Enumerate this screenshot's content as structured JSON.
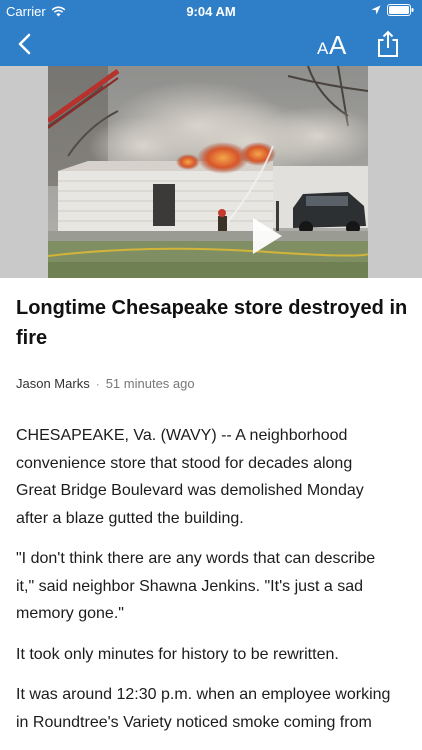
{
  "status_bar": {
    "carrier": "Carrier",
    "time": "9:04 AM",
    "icons": [
      "wifi-icon",
      "location-arrow-icon",
      "battery-icon"
    ]
  },
  "nav_bar": {
    "icons": [
      "back-chevron-icon",
      "text-size-icon",
      "share-icon"
    ],
    "text_size_glyph": "AA"
  },
  "hero": {
    "type": "video",
    "icons": [
      "play-icon"
    ]
  },
  "article": {
    "headline": "Longtime Chesapeake store destroyed in fire",
    "author": "Jason Marks",
    "separator": "·",
    "time_ago": "51 minutes ago",
    "paragraphs": [
      "CHESAPEAKE, Va. (WAVY) -- A neighborhood convenience store that stood for decades along Great Bridge Boulevard was demolished Monday after a blaze gutted the building.",
      "\"I don't think there are any words that can describe it,\" said neighbor Shawna Jenkins. \"It's just a sad memory gone.\"",
      "It took only minutes for history to be rewritten.",
      "It was around 12:30 p.m. when an employee working in Roundtree's Variety noticed smoke coming from"
    ]
  },
  "colors": {
    "accent": "#2f7fc8",
    "hero_background": "#c9c9c9",
    "text": "#1c1c1c",
    "meta_text": "#777777"
  }
}
